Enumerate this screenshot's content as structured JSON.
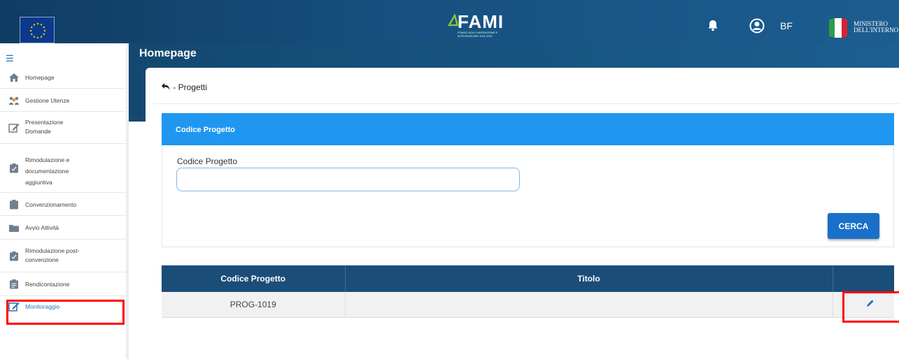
{
  "header": {
    "logo_title": "FAMI",
    "logo_subtitle": "FONDO ASILO MIGRAZIONE E INTEGRAZIONE 2021-2027",
    "user_initials": "BF",
    "ministry_line1": "MINISTERO",
    "ministry_line2": "DELL'INTERNO"
  },
  "page": {
    "title": "Homepage"
  },
  "sidebar": {
    "items": [
      {
        "label": "Homepage",
        "icon": "home-icon"
      },
      {
        "label": "Gestione Utenze",
        "icon": "users-icon"
      },
      {
        "label": "Presentazione\nDomande",
        "icon": "edit-icon"
      },
      {
        "label": "Rimodulazione e\ndocumentazione\naggiuntiva",
        "icon": "clipboard-icon"
      },
      {
        "label": "Convenzionamento",
        "icon": "clipboard-icon"
      },
      {
        "label": "Avvio Attività",
        "icon": "folder-icon"
      },
      {
        "label": "Rimodulazione post-\nconvenzione",
        "icon": "clipboard-icon"
      },
      {
        "label": "Rendicontazione",
        "icon": "clipboard-icon"
      },
      {
        "label": "Monitoraggio",
        "icon": "edit-icon"
      }
    ]
  },
  "breadcrumb": {
    "text": "- Progetti"
  },
  "search": {
    "panel_title": "Codice Progetto",
    "field_label": "Codice Progetto",
    "field_value": "",
    "button_label": "CERCA"
  },
  "table": {
    "headers": [
      "Codice Progetto",
      "Titolo",
      ""
    ],
    "rows": [
      {
        "codice": "PROG-1019",
        "titolo": ""
      }
    ]
  },
  "colors": {
    "header_dark": "#0f3c63",
    "panel_blue": "#1f97f0",
    "table_header": "#1a4d78",
    "button_blue": "#1a70c8",
    "highlight_red": "#ff0000"
  }
}
